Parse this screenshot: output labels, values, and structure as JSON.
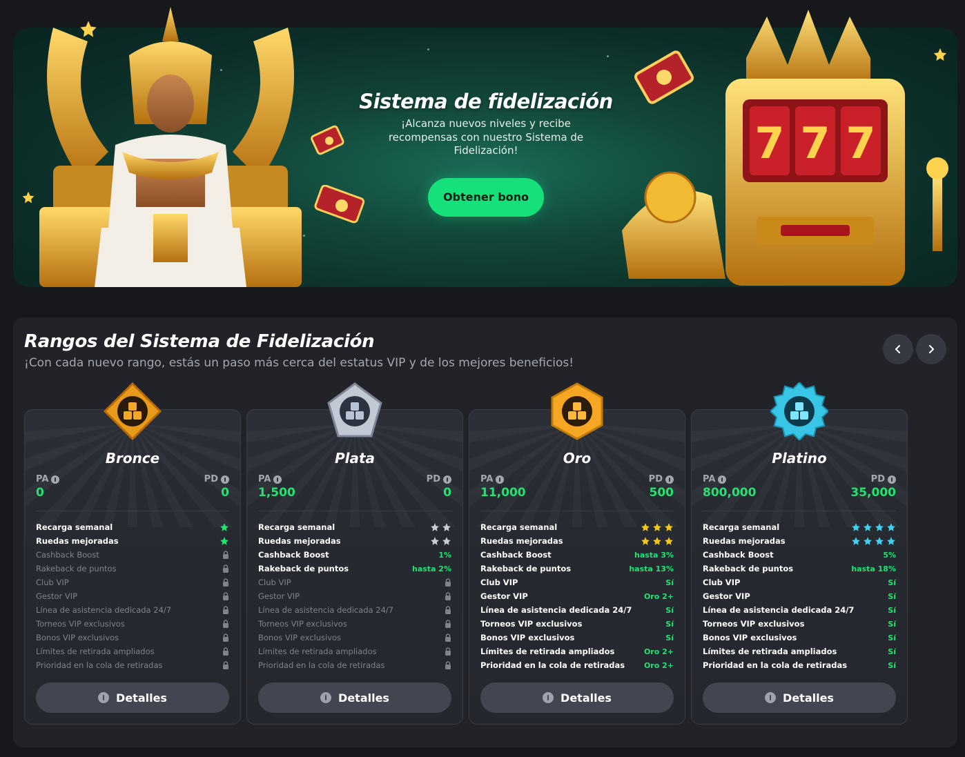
{
  "hero": {
    "title": "Sistema de fidelización",
    "subtitle": "¡Alcanza nuevos niveles y recibe recompensas con nuestro Sistema de Fidelización!",
    "button": "Obtener bono"
  },
  "ranks_section": {
    "title": "Rangos del Sistema de Fidelización",
    "subtitle": "¡Con cada nuevo rango, estás un paso más cerca del estatus VIP y de los mejores beneficios!",
    "nav_prev_icon": "chevron-left-icon",
    "nav_next_icon": "chevron-right-icon"
  },
  "colors": {
    "accent_green": "#21e46f",
    "button_green": "#16e07a",
    "star_green": "#21e46f",
    "star_silver": "#c9ccd3",
    "star_gold": "#f5c518",
    "star_cyan": "#3fd0f0"
  },
  "labels": {
    "pa": "PA",
    "pd": "PD",
    "details": "Detalles"
  },
  "cards": [
    {
      "name": "Bronce",
      "pa": "0",
      "pd": "0",
      "star_color": "#21e46f",
      "features": [
        {
          "name": "Recarga semanal",
          "stars": 1
        },
        {
          "name": "Ruedas mejoradas",
          "stars": 1
        },
        {
          "name": "Cashback Boost",
          "locked": true
        },
        {
          "name": "Rakeback de puntos",
          "locked": true
        },
        {
          "name": "Club VIP",
          "locked": true
        },
        {
          "name": "Gestor VIP",
          "locked": true
        },
        {
          "name": "Línea de asistencia dedicada 24/7",
          "locked": true
        },
        {
          "name": "Torneos VIP exclusivos",
          "locked": true
        },
        {
          "name": "Bonos VIP exclusivos",
          "locked": true
        },
        {
          "name": "Límites de retirada ampliados",
          "locked": true
        },
        {
          "name": "Prioridad en la cola de retiradas",
          "locked": true
        }
      ]
    },
    {
      "name": "Plata",
      "pa": "1,500",
      "pd": "0",
      "star_color": "#c9ccd3",
      "features": [
        {
          "name": "Recarga semanal",
          "stars": 2
        },
        {
          "name": "Ruedas mejoradas",
          "stars": 2
        },
        {
          "name": "Cashback Boost",
          "value": "1%"
        },
        {
          "name": "Rakeback de puntos",
          "value": "hasta 2%"
        },
        {
          "name": "Club VIP",
          "locked": true
        },
        {
          "name": "Gestor VIP",
          "locked": true
        },
        {
          "name": "Línea de asistencia dedicada 24/7",
          "locked": true
        },
        {
          "name": "Torneos VIP exclusivos",
          "locked": true
        },
        {
          "name": "Bonos VIP exclusivos",
          "locked": true
        },
        {
          "name": "Límites de retirada ampliados",
          "locked": true
        },
        {
          "name": "Prioridad en la cola de retiradas",
          "locked": true
        }
      ]
    },
    {
      "name": "Oro",
      "pa": "11,000",
      "pd": "500",
      "star_color": "#f5c518",
      "features": [
        {
          "name": "Recarga semanal",
          "stars": 3
        },
        {
          "name": "Ruedas mejoradas",
          "stars": 3
        },
        {
          "name": "Cashback Boost",
          "value": "hasta 3%"
        },
        {
          "name": "Rakeback de puntos",
          "value": "hasta 13%"
        },
        {
          "name": "Club VIP",
          "value": "Sí"
        },
        {
          "name": "Gestor VIP",
          "value": "Oro 2+"
        },
        {
          "name": "Línea de asistencia dedicada 24/7",
          "value": "Sí"
        },
        {
          "name": "Torneos VIP exclusivos",
          "value": "Sí"
        },
        {
          "name": "Bonos VIP exclusivos",
          "value": "Sí"
        },
        {
          "name": "Límites de retirada ampliados",
          "value": "Oro 2+"
        },
        {
          "name": "Prioridad en la cola de retiradas",
          "value": "Oro 2+"
        }
      ]
    },
    {
      "name": "Platino",
      "pa": "800,000",
      "pd": "35,000",
      "star_color": "#3fd0f0",
      "features": [
        {
          "name": "Recarga semanal",
          "stars": 4
        },
        {
          "name": "Ruedas mejoradas",
          "stars": 4
        },
        {
          "name": "Cashback Boost",
          "value": "5%"
        },
        {
          "name": "Rakeback de puntos",
          "value": "hasta 18%"
        },
        {
          "name": "Club VIP",
          "value": "Sí"
        },
        {
          "name": "Gestor VIP",
          "value": "Sí"
        },
        {
          "name": "Línea de asistencia dedicada 24/7",
          "value": "Sí"
        },
        {
          "name": "Torneos VIP exclusivos",
          "value": "Sí"
        },
        {
          "name": "Bonos VIP exclusivos",
          "value": "Sí"
        },
        {
          "name": "Límites de retirada ampliados",
          "value": "Sí"
        },
        {
          "name": "Prioridad en la cola de retiradas",
          "value": "Sí"
        }
      ]
    }
  ]
}
